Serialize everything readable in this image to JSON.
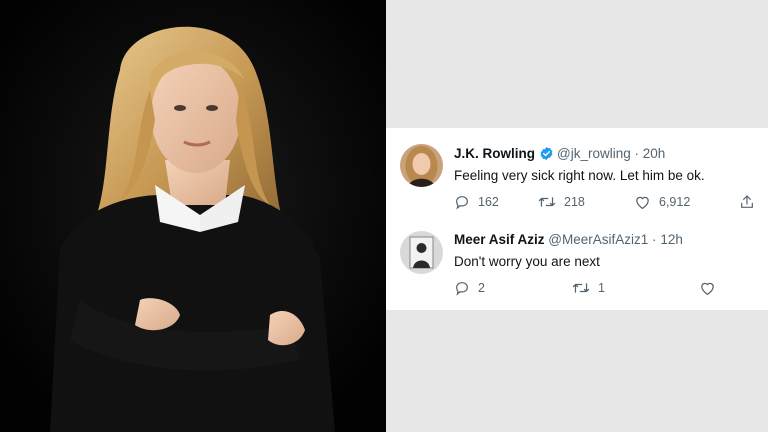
{
  "tweets": [
    {
      "name": "J.K. Rowling",
      "handle": "@jk_rowling",
      "dot": "·",
      "time": "20h",
      "text": "Feeling very sick right now. Let him be ok.",
      "replies": "162",
      "retweets": "218",
      "likes": "6,912",
      "verified": true
    },
    {
      "name": "Meer Asif Aziz",
      "handle": "@MeerAsifAziz1",
      "dot": "·",
      "time": "12h",
      "text": "Don't worry you are next",
      "replies": "2",
      "retweets": "1",
      "likes": "",
      "verified": false
    }
  ],
  "colors": {
    "verified_blue": "#1d9bf0",
    "icon_gray": "#536471",
    "card_bg": "#ffffff",
    "page_bg": "#e7e7e7"
  }
}
